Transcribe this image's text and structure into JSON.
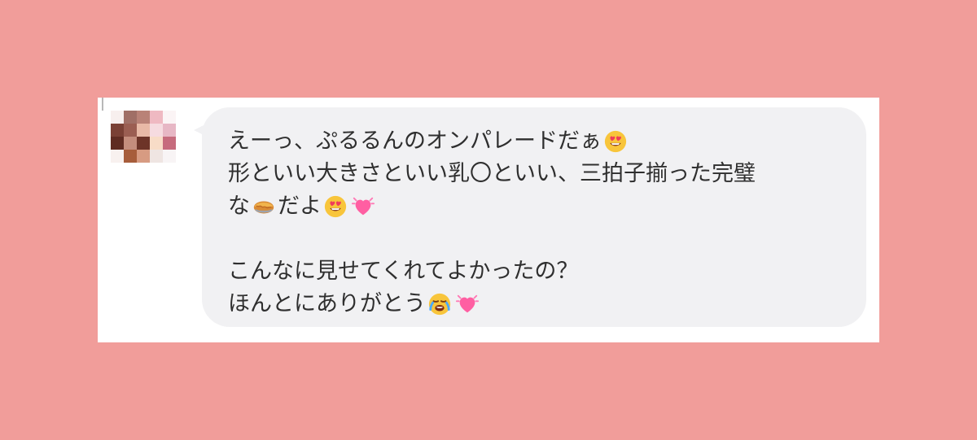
{
  "conversation": {
    "message": {
      "lines": [
        {
          "segments": [
            {
              "text": "えーっ、ぷるるんのオンパレードだぁ"
            },
            {
              "emoji": "heart-eyes-face-icon"
            }
          ]
        },
        {
          "segments": [
            {
              "text": "形といい大きさといい乳〇といい、三拍子揃った完璧"
            }
          ]
        },
        {
          "segments": [
            {
              "text": "な"
            },
            {
              "emoji": "pie-icon"
            },
            {
              "text": "だよ"
            },
            {
              "emoji": "heart-eyes-face-icon"
            },
            {
              "emoji": "growing-heart-icon"
            }
          ]
        },
        {
          "segments": []
        },
        {
          "segments": [
            {
              "text": "こんなに見せてくれてよかったの？"
            }
          ]
        },
        {
          "segments": [
            {
              "text": "ほんとにありがとう"
            },
            {
              "emoji": "crying-face-icon"
            },
            {
              "emoji": "growing-heart-icon"
            }
          ]
        }
      ]
    }
  },
  "colors": {
    "background": "#f19d9a",
    "card": "#ffffff",
    "bubble": "#f1f1f3",
    "text": "#2f2f2f"
  }
}
